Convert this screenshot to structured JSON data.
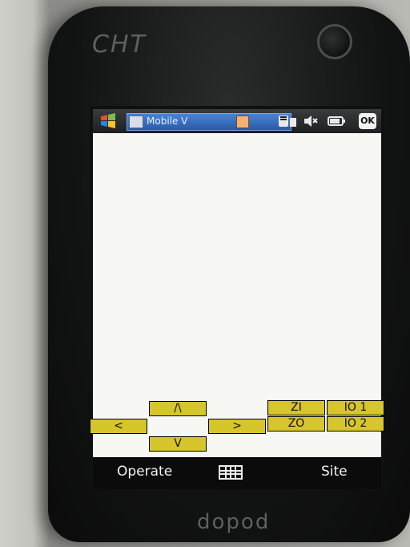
{
  "device": {
    "brand": "CHT",
    "bottom_logo": "dopod"
  },
  "taskbar": {
    "app_title": "Mobile V",
    "app_title_2": "",
    "ok_label": "OK",
    "tray_icons": [
      "sim-icon",
      "speaker-muted-icon",
      "battery-icon"
    ]
  },
  "controls": {
    "up": "/\\",
    "left": "<",
    "right": ">",
    "down": "V",
    "zoom_in": "ZI",
    "zoom_out": "ZO",
    "io1": "IO 1",
    "io2": "IO 2"
  },
  "menu": {
    "left_softkey": "Operate",
    "right_softkey": "Site",
    "center_icon": "keyboard-icon"
  },
  "colors": {
    "button_fill": "#d6c52b",
    "screen_bg": "#f7f7f4",
    "taskbar_bg": "#1e1f21",
    "active_task": "#2a5aa6"
  }
}
